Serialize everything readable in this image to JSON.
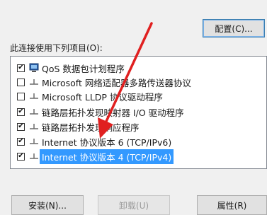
{
  "config_button": {
    "label": "配置(C)..."
  },
  "list": {
    "label": "此连接使用下列项目(O):",
    "items": [
      {
        "label": "QoS 数据包计划程序",
        "checked": true,
        "icon": "qos-scheduler-icon",
        "selected": false
      },
      {
        "label": "Microsoft 网络适配器多路传送器协议",
        "checked": false,
        "icon": "protocol-icon",
        "selected": false
      },
      {
        "label": "Microsoft LLDP 协议驱动程序",
        "checked": false,
        "icon": "protocol-icon",
        "selected": false
      },
      {
        "label": "链路层拓扑发现映射器 I/O 驱动程序",
        "checked": true,
        "icon": "protocol-icon",
        "selected": false
      },
      {
        "label": "链路层拓扑发现响应程序",
        "checked": true,
        "icon": "protocol-icon",
        "selected": false
      },
      {
        "label": "Internet 协议版本 6 (TCP/IPv6)",
        "checked": true,
        "icon": "protocol-icon",
        "selected": false
      },
      {
        "label": "Internet 协议版本 4 (TCP/IPv4)",
        "checked": true,
        "icon": "protocol-icon",
        "selected": true
      }
    ]
  },
  "buttons": {
    "install": "安装(N)...",
    "uninstall": "卸载(U)",
    "properties": "属性(R)"
  },
  "colors": {
    "selection": "#3399ff",
    "annotation_arrow": "#e02020"
  }
}
